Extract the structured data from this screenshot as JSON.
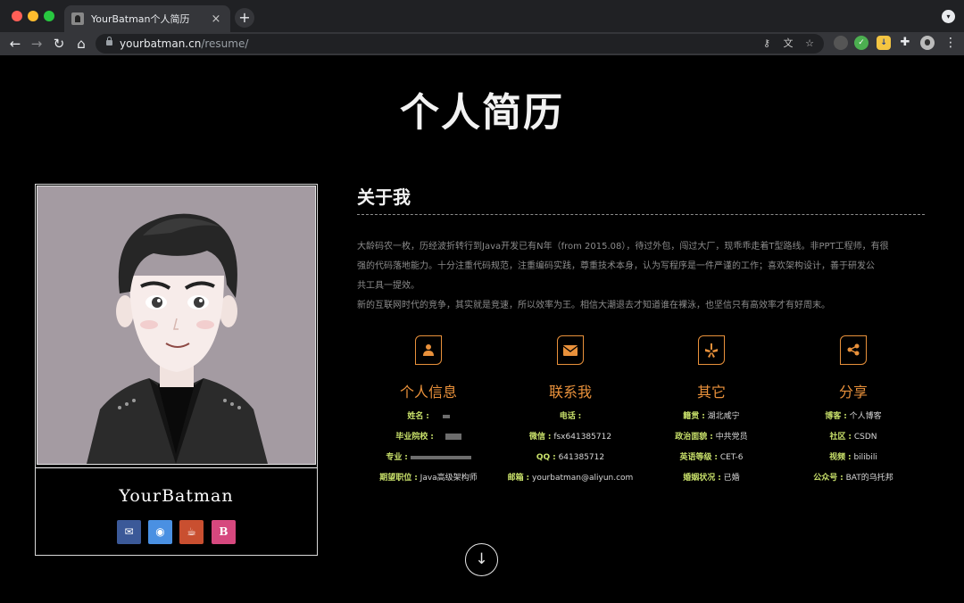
{
  "browser": {
    "tab_title": "YourBatman个人简历",
    "tab_close": "×",
    "new_tab": "+",
    "url_domain": "yourbatman.cn",
    "url_path": "/resume/",
    "icons": [
      "back-icon",
      "forward-icon",
      "reload-icon",
      "home-icon",
      "lock-icon",
      "key-icon",
      "translate-icon",
      "star-icon",
      "extension-icon",
      "puzzle-icon",
      "profile-icon",
      "menu-icon"
    ]
  },
  "page": {
    "title": "个人简历"
  },
  "profile": {
    "name": "YourBatman",
    "social": [
      {
        "icon": "mail-icon",
        "color": "#3b5998"
      },
      {
        "icon": "github-icon",
        "color": "#4a90e2"
      },
      {
        "icon": "coffee-icon",
        "color": "#c94f30"
      },
      {
        "icon": "blog-icon",
        "label": "B",
        "color": "#d6487e"
      }
    ]
  },
  "about": {
    "title": "关于我",
    "lines": [
      "大龄码农一枚，历经波折转行到Java开发已有N年（from 2015.08），待过外包，闯过大厂，现乖乖走着T型路线。非PPT工程师，有很",
      "强的代码落地能力。十分注重代码规范，注重编码实践，尊重技术本身，认为写程序是一件严谨的工作；喜欢架构设计，善于研发公",
      "共工具一提效。",
      "新的互联网时代的竞争，其实就是竞速，所以效率为王。相信大潮退去才知道谁在裸泳，也坚信只有高效率才有好周末。"
    ]
  },
  "columns": [
    {
      "icon": "user-icon",
      "title": "个人信息",
      "rows": [
        {
          "key": "姓名",
          "value": ""
        },
        {
          "key": "毕业院校",
          "value": ""
        },
        {
          "key": "专业",
          "value": ""
        },
        {
          "key": "期望职位",
          "value": "Java高级架构师"
        }
      ]
    },
    {
      "icon": "envelope-icon",
      "title": "联系我",
      "rows": [
        {
          "key": "电话",
          "value": ""
        },
        {
          "key": "微信",
          "value": "fsx641385712"
        },
        {
          "key": "QQ",
          "value": "641385712"
        },
        {
          "key": "邮箱",
          "value": "yourbatman@aliyun.com"
        }
      ]
    },
    {
      "icon": "yelp-icon",
      "title": "其它",
      "rows": [
        {
          "key": "籍贯",
          "value": "湖北咸宁"
        },
        {
          "key": "政治面貌",
          "value": "中共党员"
        },
        {
          "key": "英语等级",
          "value": "CET-6"
        },
        {
          "key": "婚姻状况",
          "value": "已婚"
        }
      ]
    },
    {
      "icon": "share-icon",
      "title": "分享",
      "rows": [
        {
          "key": "博客",
          "value": "个人博客"
        },
        {
          "key": "社区",
          "value": "CSDN"
        },
        {
          "key": "视频",
          "value": "bilibili"
        },
        {
          "key": "公众号",
          "value": "BAT的乌托邦"
        }
      ]
    }
  ],
  "row_separator": ":",
  "scroll_down": "↓",
  "colors": {
    "accent": "#e9913b",
    "label": "#c8e06a",
    "avatar_bg": "#a49ba2"
  }
}
